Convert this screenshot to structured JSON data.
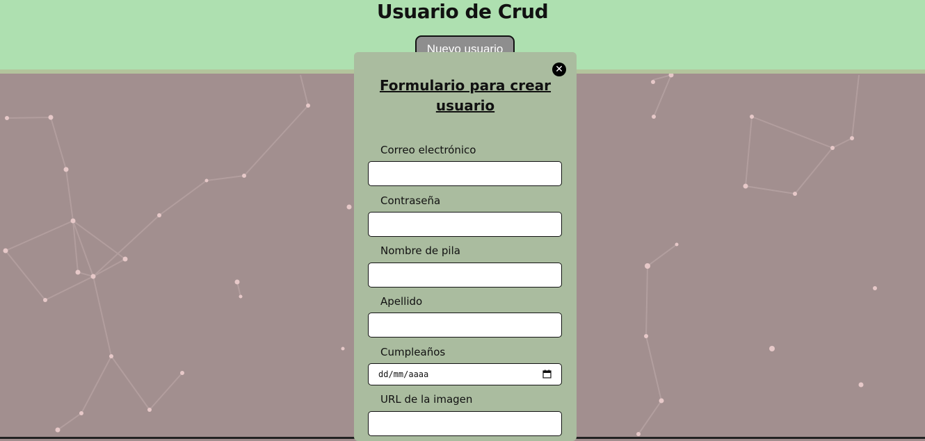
{
  "header": {
    "title": "Usuario de Crud",
    "new_user_button": "Nuevo usuario"
  },
  "modal": {
    "title": "Formulario para crear usuario",
    "close_icon": "close-icon",
    "fields": [
      {
        "label": "Correo electrónico",
        "value": ""
      },
      {
        "label": "Contraseña",
        "value": ""
      },
      {
        "label": "Nombre de pila",
        "value": ""
      },
      {
        "label": "Apellido",
        "value": ""
      },
      {
        "label": "Cumpleaños",
        "placeholder": "dd/mm/aaaa"
      },
      {
        "label": "URL de la imagen",
        "value": ""
      }
    ]
  },
  "colors": {
    "header_bg": "#aee0b0",
    "page_bg": "#a28f8f",
    "modal_bg": "#aabc9f",
    "button_bg": "#8e8e8e"
  }
}
